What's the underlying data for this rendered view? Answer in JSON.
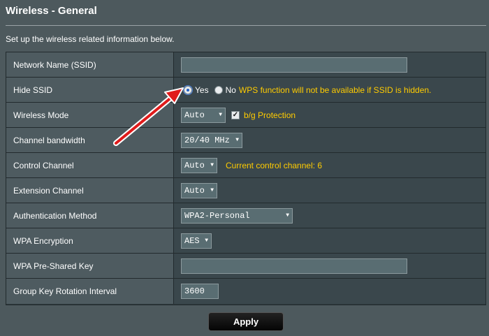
{
  "page": {
    "title": "Wireless - General",
    "description": "Set up the wireless related information below."
  },
  "rows": {
    "ssid": {
      "label": "Network Name (SSID)",
      "value": ""
    },
    "hide_ssid": {
      "label": "Hide SSID",
      "yes": "Yes",
      "no": "No",
      "selected": "Yes",
      "note": "WPS function will not be available if SSID is hidden."
    },
    "wireless_mode": {
      "label": "Wireless Mode",
      "value": "Auto",
      "protection_label": "b/g Protection",
      "protection_checked": true
    },
    "channel_bandwidth": {
      "label": "Channel bandwidth",
      "value": "20/40 MHz"
    },
    "control_channel": {
      "label": "Control Channel",
      "value": "Auto",
      "note": "Current control channel: 6"
    },
    "extension_channel": {
      "label": "Extension Channel",
      "value": "Auto"
    },
    "auth_method": {
      "label": "Authentication Method",
      "value": "WPA2-Personal"
    },
    "wpa_encryption": {
      "label": "WPA Encryption",
      "value": "AES"
    },
    "wpa_psk": {
      "label": "WPA Pre-Shared Key",
      "value": ""
    },
    "group_key": {
      "label": "Group Key Rotation Interval",
      "value": "3600"
    }
  },
  "buttons": {
    "apply": "Apply"
  },
  "colors": {
    "background": "#4d595d",
    "note": "#ffcc00",
    "arrow": "#e01b1b"
  },
  "icons": {
    "select_arrow": "▼",
    "check": "✓"
  }
}
